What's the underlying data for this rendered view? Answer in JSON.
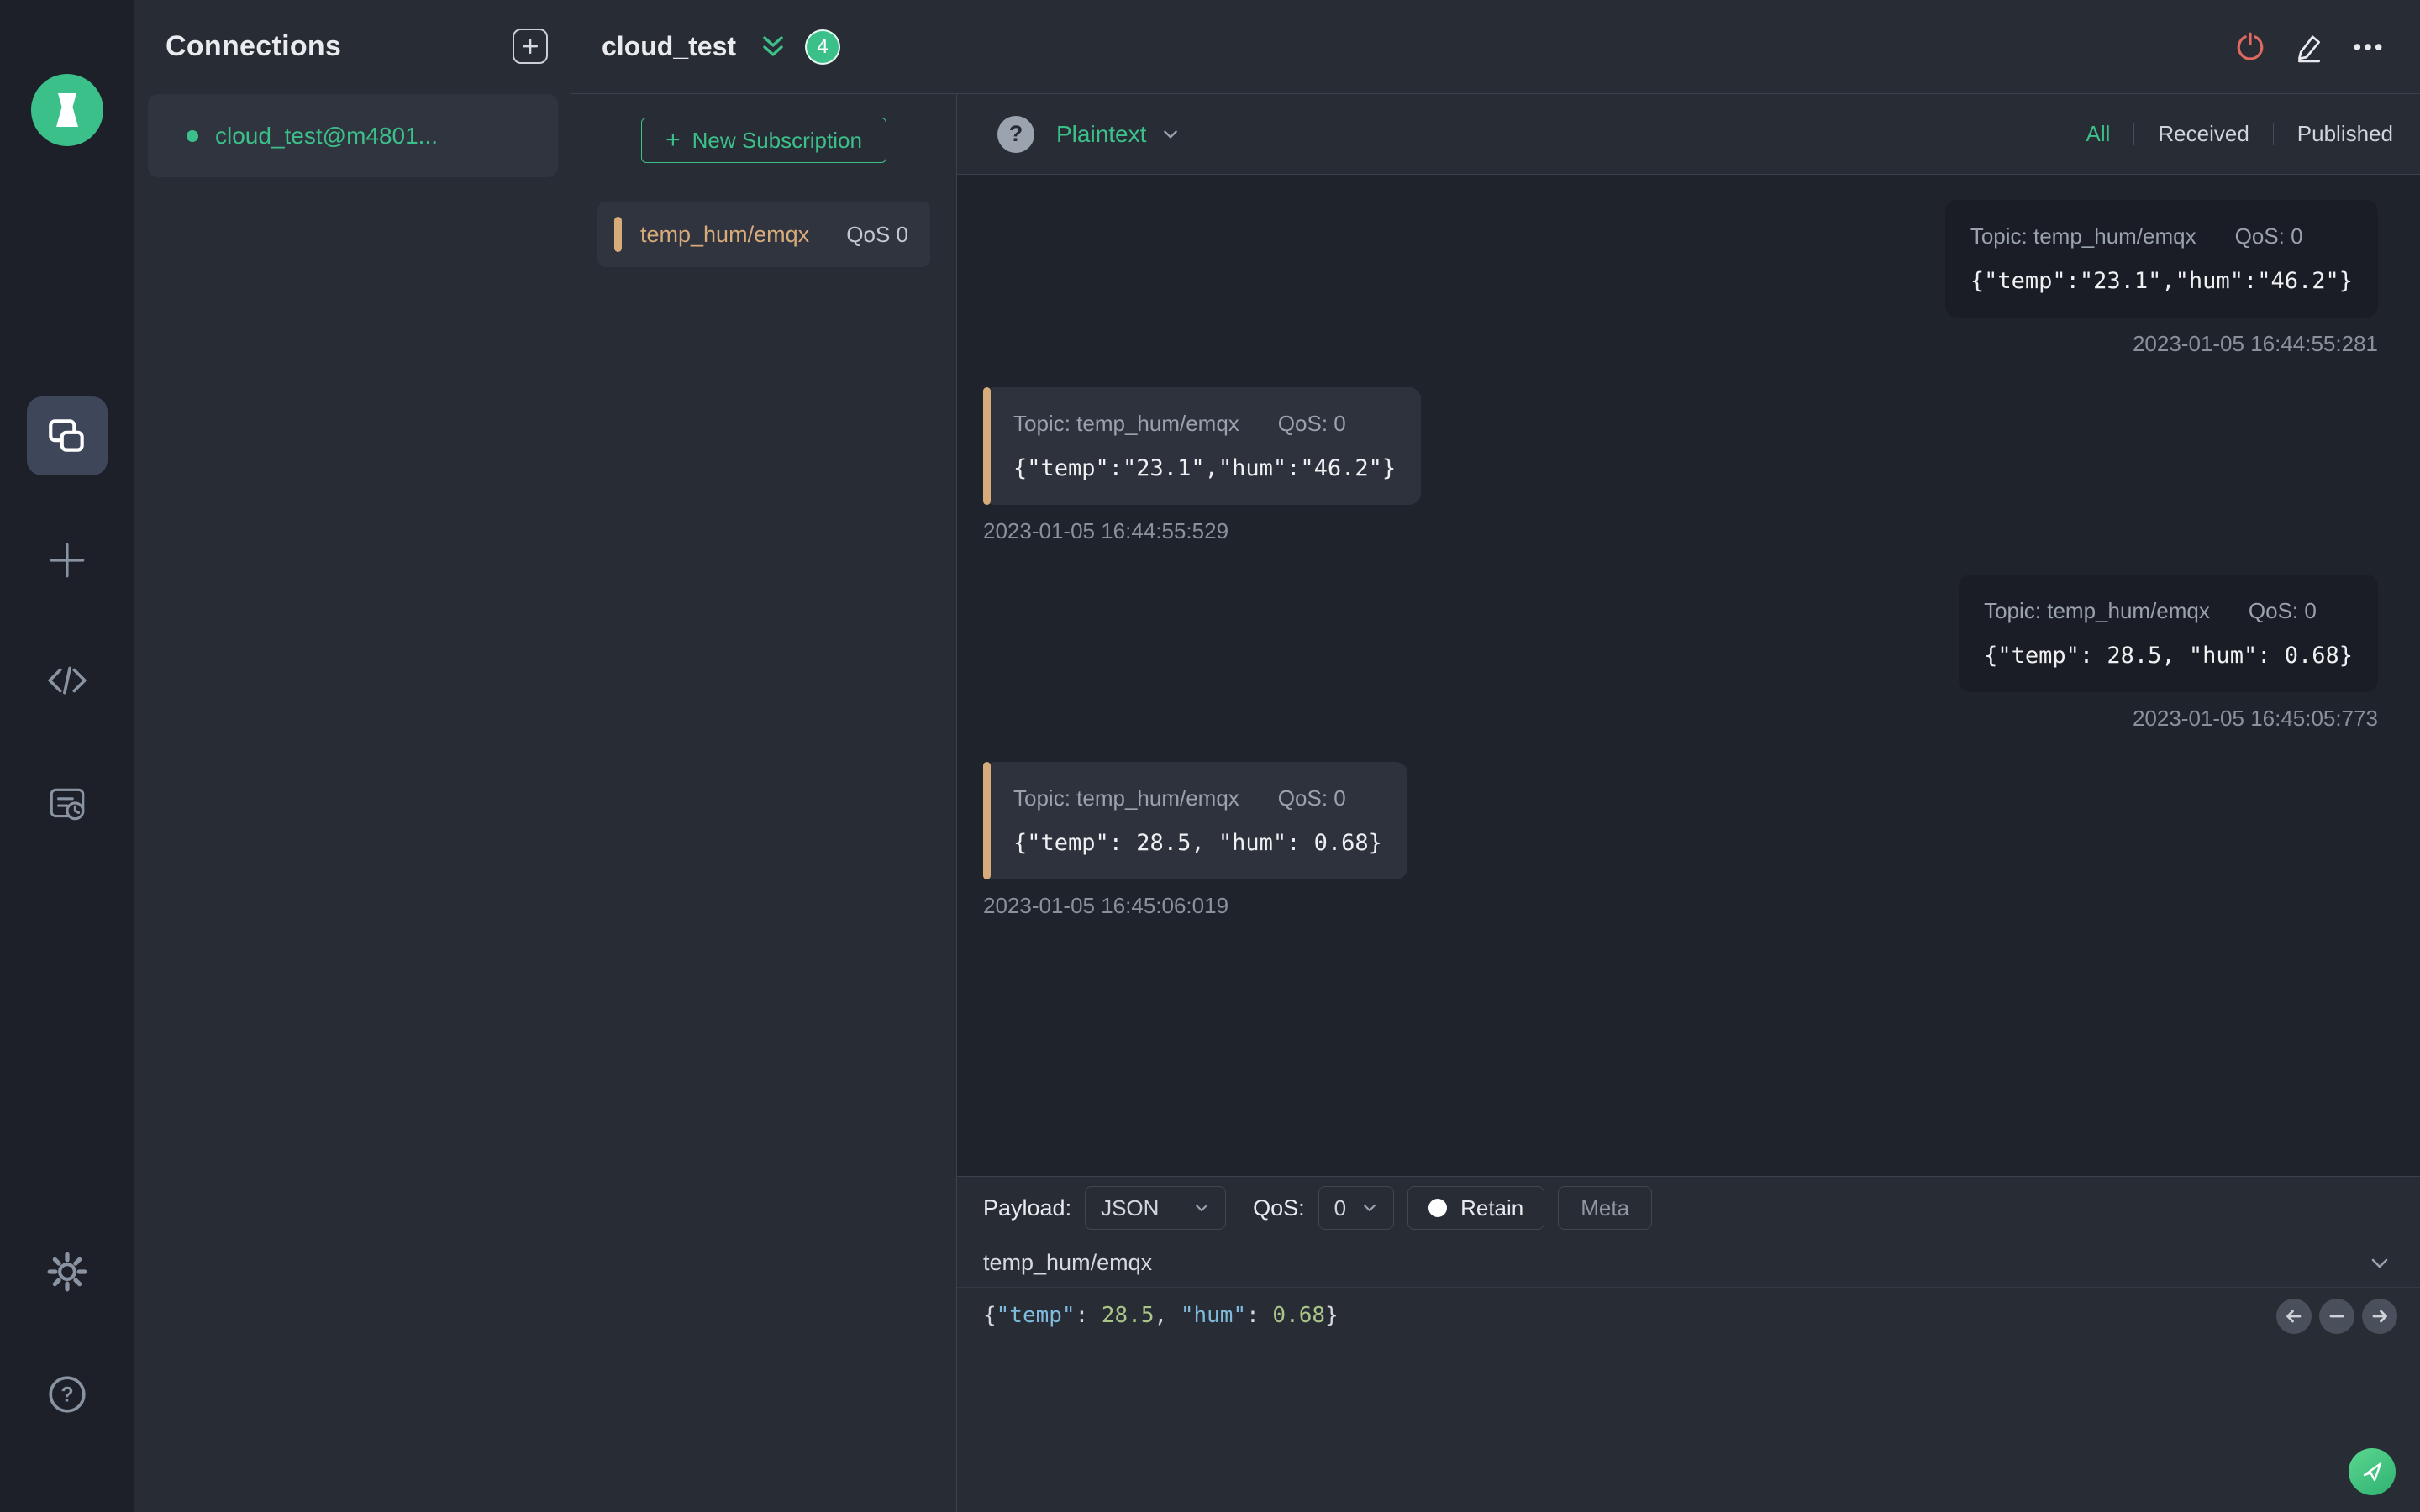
{
  "colors": {
    "green": "#3cc08a",
    "tan": "#d8ab7a",
    "red": "#e2695f",
    "syntax_key": "#7fb9dc",
    "syntax_num": "#a9c588"
  },
  "sidebar": {
    "icons": [
      "mqttx-logo",
      "connections",
      "new-connection",
      "script",
      "log",
      "settings",
      "help"
    ]
  },
  "connections": {
    "title": "Connections",
    "items": [
      {
        "name": "cloud_test@m4801...",
        "status": "connected"
      }
    ]
  },
  "header": {
    "title": "cloud_test",
    "badge_count": "4"
  },
  "subscriptions": {
    "new_button": "New Subscription",
    "items": [
      {
        "topic": "temp_hum/emqx",
        "qos": "QoS 0"
      }
    ]
  },
  "messages": {
    "format": "Plaintext",
    "filters": [
      "All",
      "Received",
      "Published"
    ],
    "active_filter": "All",
    "topic_prefix": "Topic: ",
    "qos_prefix": "QoS: ",
    "items": [
      {
        "direction": "published",
        "topic": "temp_hum/emqx",
        "qos": "0",
        "payload": "{\"temp\":\"23.1\",\"hum\":\"46.2\"}",
        "timestamp": "2023-01-05 16:44:55:281"
      },
      {
        "direction": "received",
        "topic": "temp_hum/emqx",
        "qos": "0",
        "payload": "{\"temp\":\"23.1\",\"hum\":\"46.2\"}",
        "timestamp": "2023-01-05 16:44:55:529"
      },
      {
        "direction": "published",
        "topic": "temp_hum/emqx",
        "qos": "0",
        "payload": "{\"temp\": 28.5, \"hum\": 0.68}",
        "timestamp": "2023-01-05 16:45:05:773"
      },
      {
        "direction": "received",
        "topic": "temp_hum/emqx",
        "qos": "0",
        "payload": "{\"temp\": 28.5, \"hum\": 0.68}",
        "timestamp": "2023-01-05 16:45:06:019"
      }
    ]
  },
  "publish": {
    "payload_label": "Payload:",
    "payload_type": "JSON",
    "qos_label": "QoS:",
    "qos_value": "0",
    "retain_label": "Retain",
    "meta_label": "Meta",
    "topic": "temp_hum/emqx",
    "payload_tokens": [
      {
        "type": "punct",
        "text": "{"
      },
      {
        "type": "key",
        "text": "\"temp\""
      },
      {
        "type": "punct",
        "text": ": "
      },
      {
        "type": "num",
        "text": "28.5"
      },
      {
        "type": "punct",
        "text": ", "
      },
      {
        "type": "key",
        "text": "\"hum\""
      },
      {
        "type": "punct",
        "text": ": "
      },
      {
        "type": "num",
        "text": "0.68"
      },
      {
        "type": "punct",
        "text": "}"
      }
    ]
  }
}
